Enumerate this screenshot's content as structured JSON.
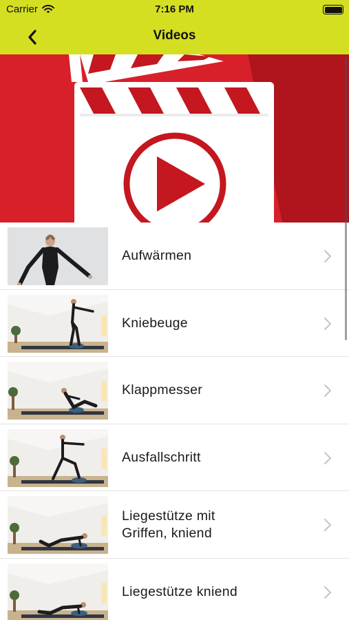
{
  "status_bar": {
    "carrier": "Carrier",
    "time": "7:16 PM",
    "icons": [
      "wifi-icon",
      "battery-icon"
    ]
  },
  "nav": {
    "title": "Videos",
    "back_icon": "chevron-left-icon"
  },
  "hero": {
    "icons": [
      "clapperboard-icon",
      "play-icon"
    ],
    "colors": {
      "red": "#d8202a",
      "dark_red": "#b0141d",
      "white": "#ffffff"
    }
  },
  "videos": [
    {
      "label": "Aufwärmen",
      "thumbnail": "warm-up-thumbnail"
    },
    {
      "label": "Kniebeuge",
      "thumbnail": "squat-thumbnail"
    },
    {
      "label": "Klappmesser",
      "thumbnail": "jackknife-thumbnail"
    },
    {
      "label": "Ausfallschritt",
      "thumbnail": "lunge-thumbnail"
    },
    {
      "label": "Liegestütze mit\nGriffen, kniend",
      "thumbnail": "pushup-grips-thumbnail"
    },
    {
      "label": "Liegestütze kniend",
      "thumbnail": "pushup-kneeling-thumbnail"
    }
  ],
  "colors": {
    "accent": "#d4df22",
    "divider": "#e3e3e3",
    "chevron": "#c4c4c4"
  }
}
